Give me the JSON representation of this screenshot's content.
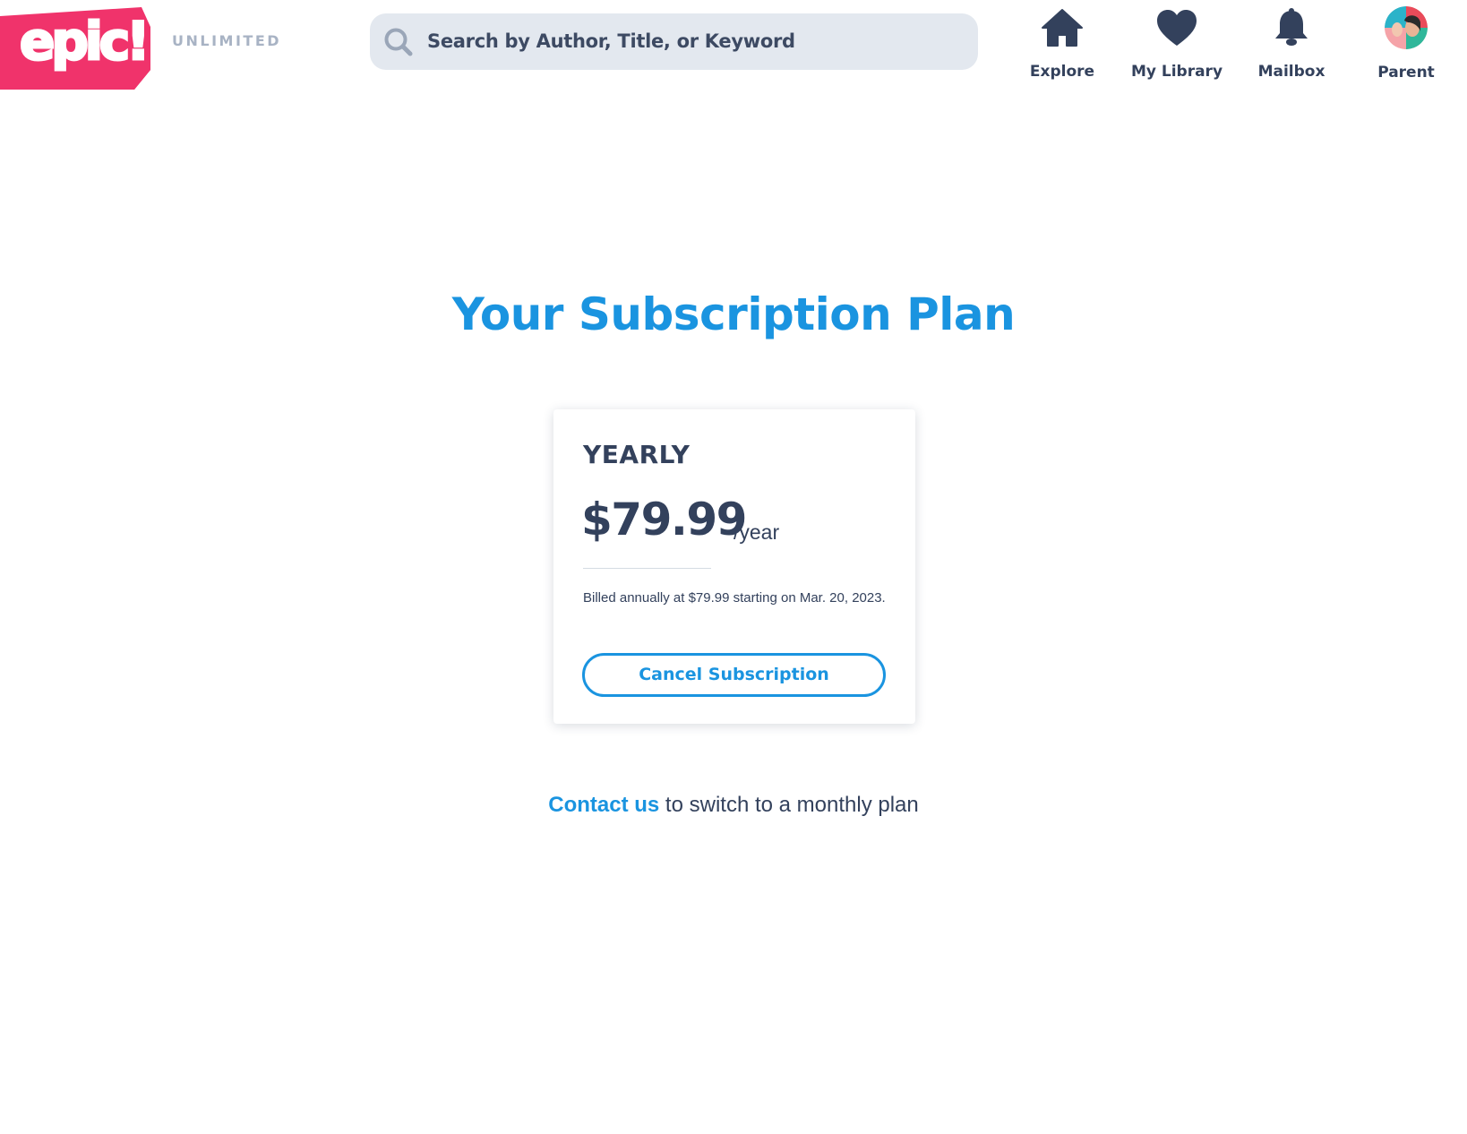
{
  "brand": {
    "logo_text": "epic!",
    "tier": "UNLIMITED",
    "accent_color": "#f0336b"
  },
  "search": {
    "placeholder": "Search by Author, Title, or Keyword",
    "icon": "search-icon"
  },
  "nav": {
    "items": [
      {
        "label": "Explore",
        "icon": "home-icon"
      },
      {
        "label": "My Library",
        "icon": "heart-icon"
      },
      {
        "label": "Mailbox",
        "icon": "bell-icon"
      },
      {
        "label": "Parent",
        "icon": "avatar"
      }
    ]
  },
  "main": {
    "title": "Your Subscription Plan",
    "title_color": "#1a94e0"
  },
  "plan": {
    "name": "YEARLY",
    "price": "$79.99",
    "period": "/year",
    "billing_note": "Billed annually at $79.99 starting on Mar. 20, 2023.",
    "cancel_label": "Cancel Subscription"
  },
  "footer": {
    "contact_link": "Contact us",
    "contact_text": " to switch to a monthly plan"
  }
}
